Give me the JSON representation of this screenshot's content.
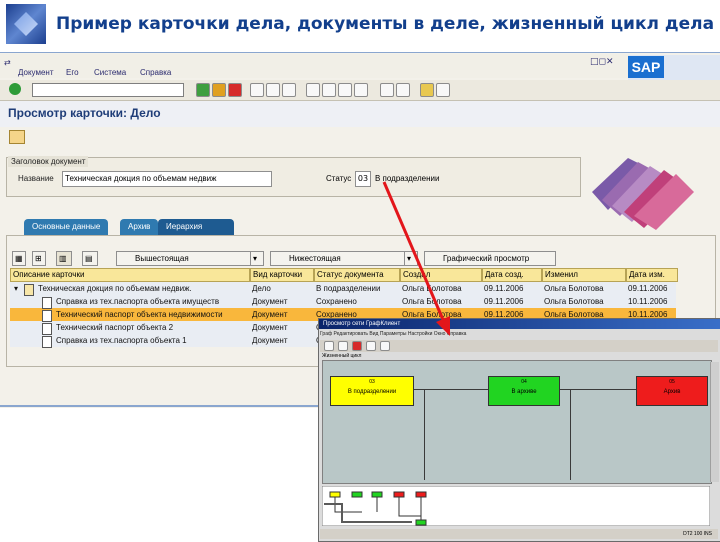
{
  "slide": {
    "title": "Пример карточки дела, документы в деле, жизненный цикл дела"
  },
  "menu": [
    "Документ",
    "Его",
    "Система",
    "Справка"
  ],
  "window_controls": "□◻✕",
  "sap_logo": "SAP",
  "screen_title": "Просмотр карточки: Дело",
  "header": {
    "section_label": "Заголовок документ",
    "name_label": "Название",
    "name_value": "Техническая докция по объемам недвиж",
    "status_label": "Статус",
    "status_code": "03",
    "status_text": "В подразделении"
  },
  "tabs": [
    {
      "label": "Основные данные"
    },
    {
      "label": "Архив"
    },
    {
      "label": "Иерархия"
    }
  ],
  "table_toolbar": {
    "btn_up": "Вышестоящая",
    "btn_down": "Нижестоящая",
    "btn_graph": "Графический просмотр"
  },
  "table": {
    "headers": [
      "Описание карточки",
      "Вид карточки",
      "Статус документа",
      "Создал",
      "Дата созд.",
      "Изменил",
      "Дата изм."
    ],
    "rows": [
      {
        "desc": "Техническая докция по объемам недвиж.",
        "type": "Дело",
        "status": "В подразделении",
        "created_by": "Ольга Болотова",
        "created": "09.11.2006",
        "changed_by": "Ольга Болотова",
        "changed": "09.11.2006"
      },
      {
        "desc": "Справка из тех.паспорта объекта имуществ",
        "type": "Документ",
        "status": "Сохранено",
        "created_by": "Ольга Болотова",
        "created": "09.11.2006",
        "changed_by": "Ольга Болотова",
        "changed": "10.11.2006"
      },
      {
        "desc": "Технический паспорт объекта недвижимости",
        "type": "Документ",
        "status": "Сохранено",
        "created_by": "Ольга Болотова",
        "created": "09.11.2006",
        "changed_by": "Ольга Болотова",
        "changed": "10.11.2006"
      },
      {
        "desc": "Технический паспорт объекта 2",
        "type": "Документ",
        "status": "Сохранено",
        "created_by": "",
        "created": "",
        "changed_by": "",
        "changed": ""
      },
      {
        "desc": "Справка из тех.паспорта объекта 1",
        "type": "Документ",
        "status": "Сохранено",
        "created_by": "",
        "created": "",
        "changed_by": "",
        "changed": ""
      }
    ]
  },
  "overlay": {
    "title": "Просмотр сети ГрафКлиент",
    "menu": "Граф Редактировать Вид Параметры Настройки Окно Справка",
    "section": "Жизненный цикл",
    "nodes": [
      {
        "code": "03",
        "label": "В подразделении",
        "color": "#ffff00"
      },
      {
        "code": "04",
        "label": "В архиве",
        "color": "#21d421"
      },
      {
        "code": "05",
        "label": "Архив",
        "color": "#ee1c1c"
      }
    ],
    "status": "DT2 100 INS"
  },
  "colors": {
    "accent": "#1e5b91",
    "selected_row": "#f9b73c",
    "header_cells": "#f9e79a",
    "arrow": "#e3161b"
  }
}
